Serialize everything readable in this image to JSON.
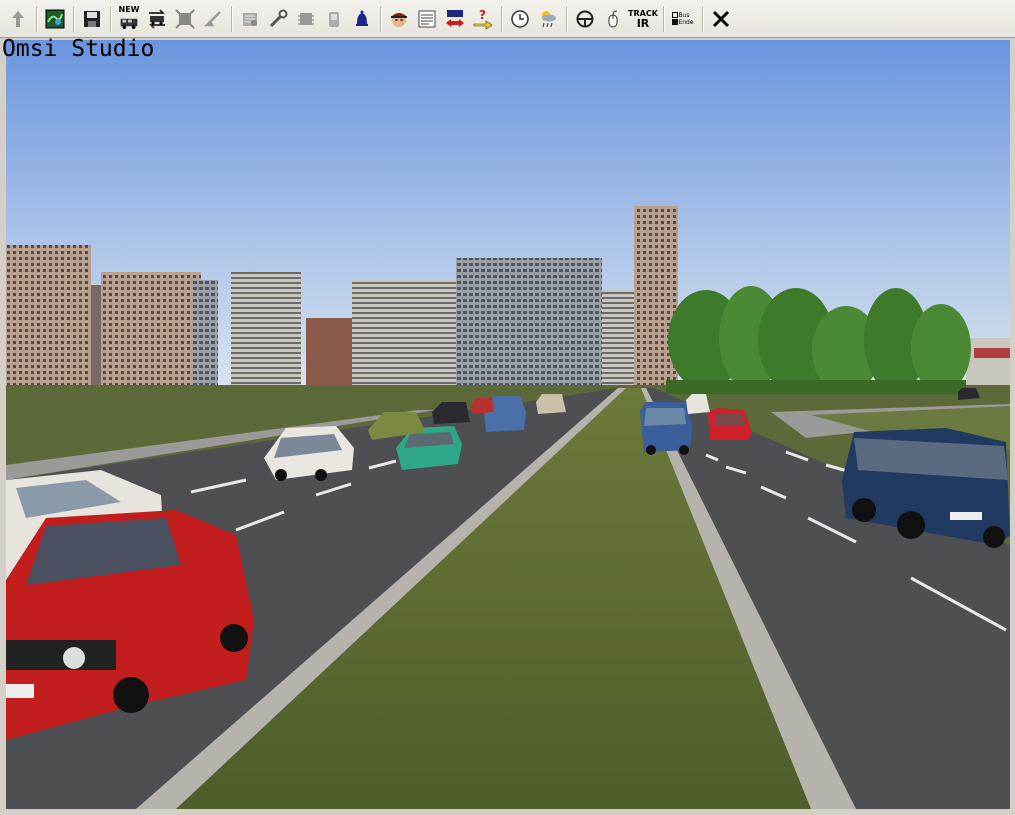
{
  "app": {
    "overlay_title": "Omsi Studio"
  },
  "toolbar": {
    "new_label": "NEW",
    "track_label": "TRACK",
    "ir_label": "IR",
    "check1_label": "Bus",
    "check2_label": "Ende",
    "buttons": [
      "arrow-up-icon",
      "map-icon",
      "save-icon",
      "new-bus-icon",
      "swap-bus-icon",
      "frame-icon",
      "pointer-icon",
      "ticket-icon",
      "wrench-icon",
      "chip-icon",
      "door-icon",
      "bell-icon",
      "driver-icon",
      "schedule-icon",
      "route-swap-icon",
      "help-arrow-icon",
      "clock-icon",
      "weather-icon",
      "steering-wheel-icon",
      "mouse-icon",
      "trackir-icon",
      "checkbox-icon",
      "close-icon"
    ]
  },
  "colors": {
    "sky_top": "#6a95de",
    "sky_bottom": "#d9e4ee",
    "grass": "#5c6a3a",
    "road": "#4e4f52",
    "toolbar_bg": "#ecebe5"
  }
}
